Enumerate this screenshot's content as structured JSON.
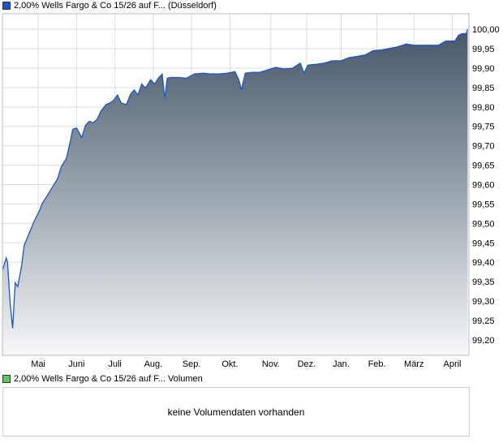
{
  "chart_data": {
    "type": "area",
    "title": "2,00% Wells Fargo & Co 15/26 auf F... (Düsseldorf)",
    "series_color": "#1a56c4",
    "x_unit": "days",
    "xlim": [
      0,
      365
    ],
    "ylim": [
      99.16,
      100.04
    ],
    "yticks": [
      100.0,
      99.95,
      99.9,
      99.85,
      99.8,
      99.75,
      99.7,
      99.65,
      99.6,
      99.55,
      99.5,
      99.45,
      99.4,
      99.35,
      99.3,
      99.25,
      99.2
    ],
    "ytick_labels": [
      "100,00",
      "99,95",
      "99,90",
      "99,85",
      "99,80",
      "99,75",
      "99,70",
      "99,65",
      "99,60",
      "99,55",
      "99,50",
      "99,45",
      "99,40",
      "99,35",
      "99,30",
      "99,25",
      "99,20"
    ],
    "xticks": [
      {
        "label": "Mai",
        "x": 28
      },
      {
        "label": "Juni",
        "x": 58
      },
      {
        "label": "Juli",
        "x": 88
      },
      {
        "label": "Aug.",
        "x": 118
      },
      {
        "label": "Sep.",
        "x": 148
      },
      {
        "label": "Okt.",
        "x": 178
      },
      {
        "label": "Nov.",
        "x": 210
      },
      {
        "label": "Dez.",
        "x": 238
      },
      {
        "label": "Jan.",
        "x": 265
      },
      {
        "label": "Feb.",
        "x": 293
      },
      {
        "label": "März",
        "x": 322
      },
      {
        "label": "April",
        "x": 352
      }
    ],
    "grid": true,
    "x": [
      0,
      3,
      4,
      6,
      8,
      10,
      12,
      15,
      17,
      21,
      25,
      29,
      31,
      35,
      39,
      43,
      46,
      50,
      53,
      55,
      58,
      62,
      65,
      68,
      71,
      74,
      77,
      81,
      84,
      87,
      90,
      93,
      97,
      100,
      103,
      106,
      109,
      112,
      116,
      119,
      122,
      125,
      127,
      129,
      131,
      138,
      144,
      150,
      157,
      163,
      170,
      176,
      182,
      185,
      187,
      190,
      195,
      201,
      208,
      214,
      220,
      227,
      233,
      236,
      239,
      246,
      252,
      258,
      265,
      271,
      277,
      284,
      290,
      297,
      303,
      309,
      316,
      322,
      328,
      335,
      341,
      347,
      354,
      357,
      360,
      363,
      364
    ],
    "values": [
      99.379,
      99.411,
      99.4,
      99.294,
      99.23,
      99.347,
      99.337,
      99.39,
      99.443,
      99.475,
      99.507,
      99.533,
      99.55,
      99.571,
      99.593,
      99.614,
      99.646,
      99.667,
      99.71,
      99.742,
      99.746,
      99.721,
      99.753,
      99.763,
      99.759,
      99.768,
      99.789,
      99.806,
      99.81,
      99.817,
      99.831,
      99.81,
      99.806,
      99.831,
      99.844,
      99.831,
      99.859,
      99.849,
      99.87,
      99.859,
      99.874,
      99.885,
      99.823,
      99.874,
      99.876,
      99.876,
      99.874,
      99.885,
      99.887,
      99.885,
      99.885,
      99.887,
      99.891,
      99.87,
      99.844,
      99.887,
      99.889,
      99.889,
      99.896,
      99.902,
      99.898,
      99.9,
      99.913,
      99.887,
      99.908,
      99.91,
      99.913,
      99.919,
      99.919,
      99.927,
      99.93,
      99.934,
      99.945,
      99.947,
      99.951,
      99.955,
      99.962,
      99.959,
      99.959,
      99.959,
      99.959,
      99.97,
      99.97,
      99.985,
      99.989,
      99.989,
      100.0
    ]
  },
  "volume": {
    "title": "2,00% Wells Fargo & Co 15/26 auf F... Volumen",
    "legend_color": "#5cc85c",
    "message": "keine Volumendaten vorhanden"
  }
}
